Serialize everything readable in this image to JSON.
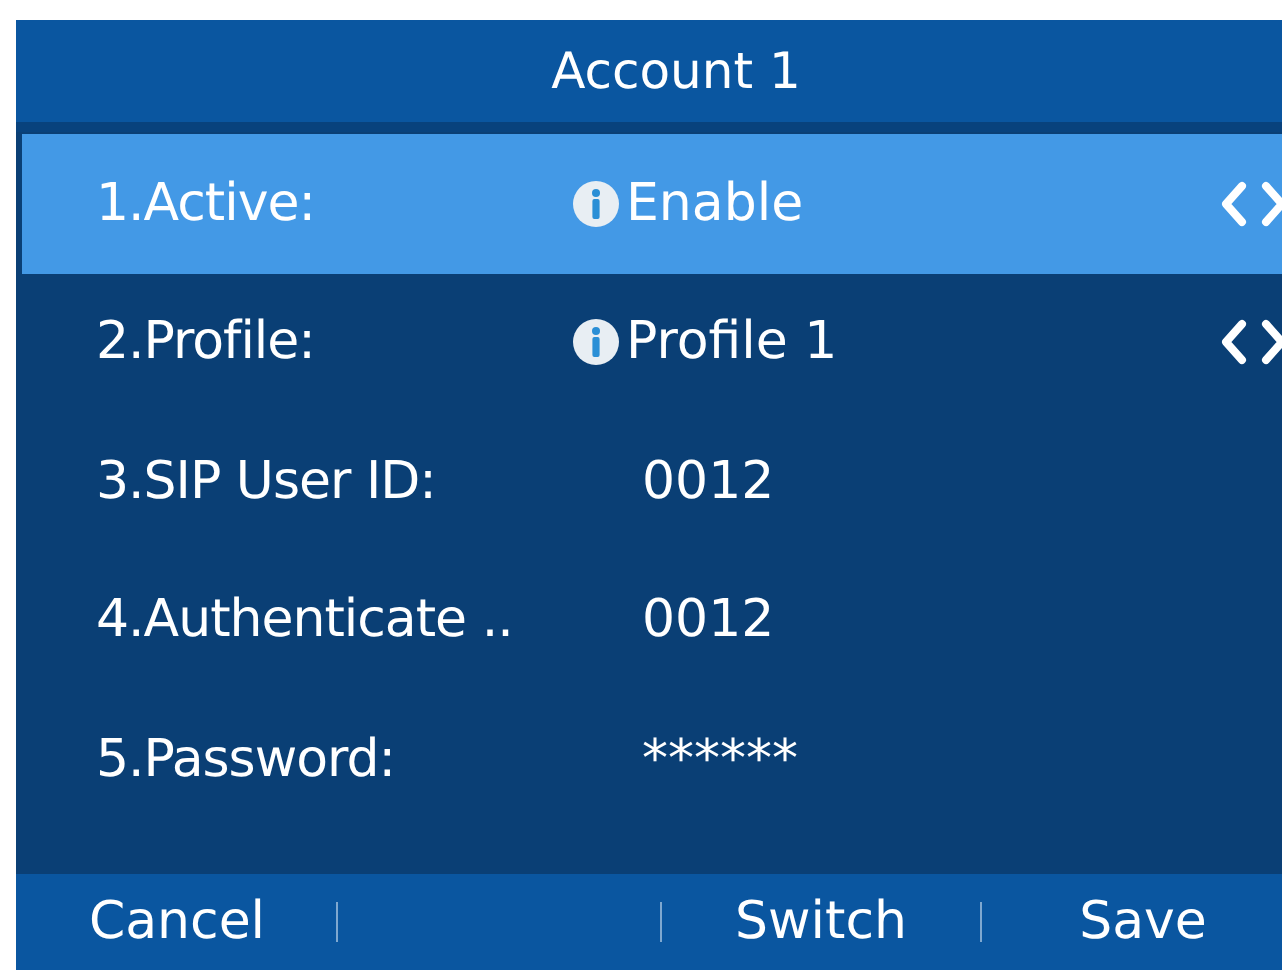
{
  "title": "Account 1",
  "rows": [
    {
      "kind": "option",
      "label": "1.Active:",
      "value": "Enable",
      "selected": true
    },
    {
      "kind": "option",
      "label": "2.Profile:",
      "value": "Profile 1",
      "selected": false
    },
    {
      "kind": "text",
      "label": "3.SIP User ID:",
      "value": "0012",
      "selected": false
    },
    {
      "kind": "text",
      "label": "4.Authenticate ..",
      "value": "0012",
      "selected": false
    },
    {
      "kind": "text",
      "label": "5.Password:",
      "value": "******",
      "selected": false
    }
  ],
  "softkeys": [
    {
      "label": "Cancel"
    },
    {
      "label": "Switch"
    },
    {
      "label": "Save"
    }
  ]
}
